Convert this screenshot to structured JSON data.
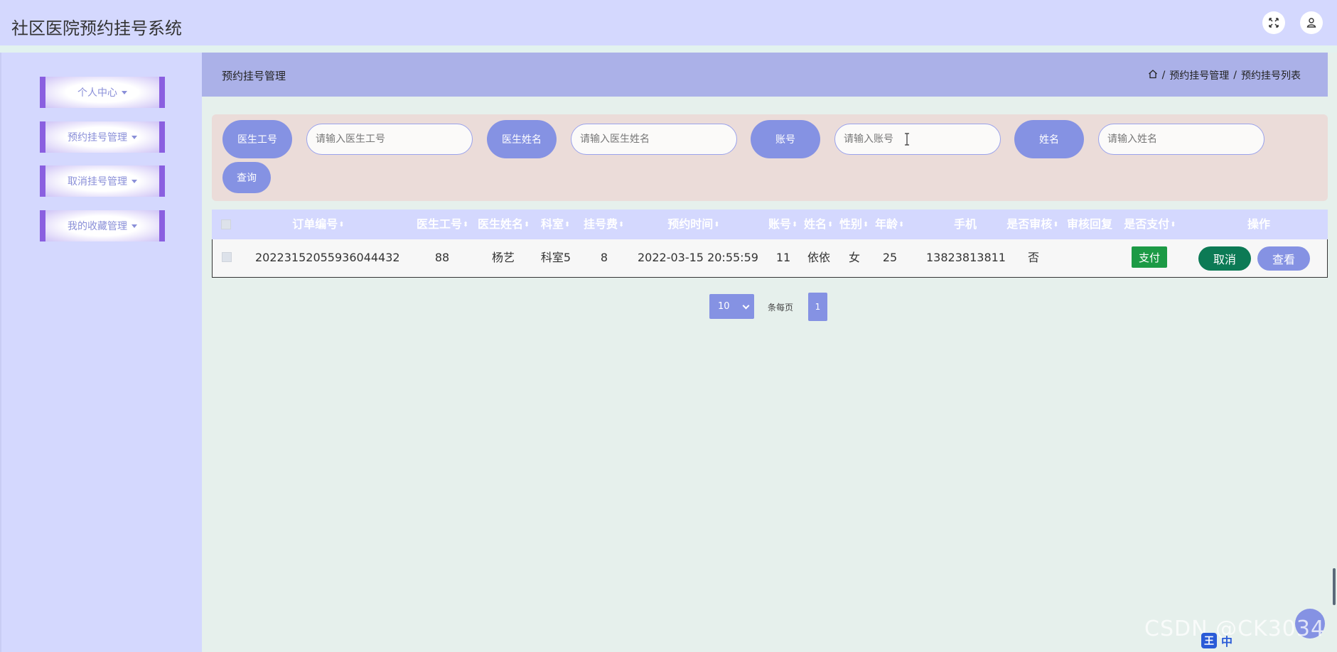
{
  "app": {
    "title": "社区医院预约挂号系统"
  },
  "sidebar": {
    "items": [
      {
        "label": "个人中心"
      },
      {
        "label": "预约挂号管理"
      },
      {
        "label": "取消挂号管理"
      },
      {
        "label": "我的收藏管理"
      }
    ]
  },
  "header": {
    "title": "预约挂号管理",
    "breadcrumb": [
      "预约挂号管理",
      "预约挂号列表"
    ],
    "separator": "/"
  },
  "search": {
    "fields": [
      {
        "label": "医生工号",
        "placeholder": "请输入医生工号",
        "value": ""
      },
      {
        "label": "医生姓名",
        "placeholder": "请输入医生姓名",
        "value": ""
      },
      {
        "label": "账号",
        "placeholder": "请输入账号",
        "value": ""
      },
      {
        "label": "姓名",
        "placeholder": "请输入姓名",
        "value": ""
      }
    ],
    "query_label": "查询"
  },
  "table": {
    "columns": [
      "订单编号",
      "医生工号",
      "医生姓名",
      "科室",
      "挂号费",
      "预约时间",
      "账号",
      "姓名",
      "性别",
      "年龄",
      "手机",
      "是否审核",
      "审核回复",
      "是否支付",
      "操作"
    ],
    "rows": [
      {
        "order_no": "20223152055936044432",
        "doctor_id": "88",
        "doctor_name": "杨艺",
        "department": "科室5",
        "fee": "8",
        "time": "2022-03-15 20:55:59",
        "account": "11",
        "name": "依依",
        "gender": "女",
        "age": "25",
        "phone": "13823813811",
        "reviewed": "否",
        "review_reply": "",
        "pay_label": "支付",
        "cancel_label": "取消",
        "view_label": "查看"
      }
    ]
  },
  "pagination": {
    "page_size": "10",
    "page_size_suffix": "条每页",
    "current_page": "1"
  },
  "watermark": "CSDN @CK3034",
  "ime": {
    "logo": "王",
    "mode": "中"
  },
  "colors": {
    "topbar": "#d4d8fe",
    "accent": "#8592e3",
    "menu_border": "#8a5fe0",
    "pay": "#1c9a45",
    "cancel": "#0c7a55",
    "search_panel": "#ebdcd9"
  },
  "icons": [
    "fullscreen-icon",
    "user-icon",
    "home-icon",
    "sort-icon",
    "chevron-down-icon",
    "text-cursor-icon"
  ]
}
